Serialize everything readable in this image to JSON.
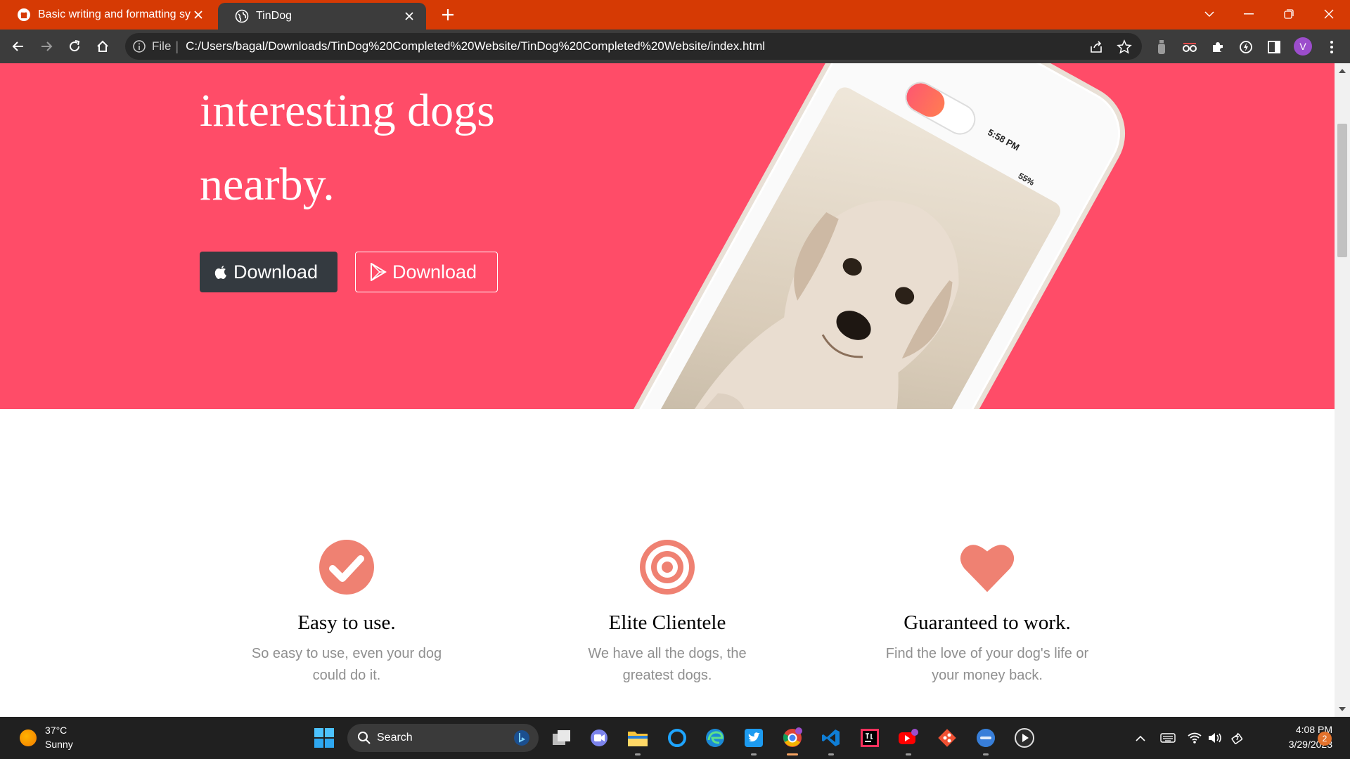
{
  "tabs": [
    {
      "label": "Basic writing and formatting synt",
      "icon": "github-icon",
      "active": false
    },
    {
      "label": "TinDog",
      "icon": "globe-icon",
      "active": true
    }
  ],
  "omnibox": {
    "scheme": "File",
    "separator": "|",
    "url": "C:/Users/bagal/Downloads/TinDog%20Completed%20Website/TinDog%20Completed%20Website/index.html"
  },
  "profile_initial": "V",
  "hero": {
    "line1": "interesting dogs",
    "line2": "nearby.",
    "apple_button": "Download",
    "play_button": "Download",
    "background": "#ff4c68"
  },
  "phone": {
    "time": "5:58 PM",
    "battery": "55%"
  },
  "features": [
    {
      "icon": "check-circle-icon",
      "title": "Easy to use.",
      "line1": "So easy to use, even your dog",
      "line2": "could do it."
    },
    {
      "icon": "bullseye-icon",
      "title": "Elite Clientele",
      "line1": "We have all the dogs, the",
      "line2": "greatest dogs."
    },
    {
      "icon": "heart-icon",
      "title": "Guaranteed to work.",
      "line1": "Find the love of your dog's life or",
      "line2": "your money back."
    }
  ],
  "accent_color": "#ef8172",
  "taskbar": {
    "temperature": "37°C",
    "condition": "Sunny",
    "search_label": "Search",
    "time": "4:08 PM",
    "date": "3/29/2023",
    "notification_count": "2"
  }
}
